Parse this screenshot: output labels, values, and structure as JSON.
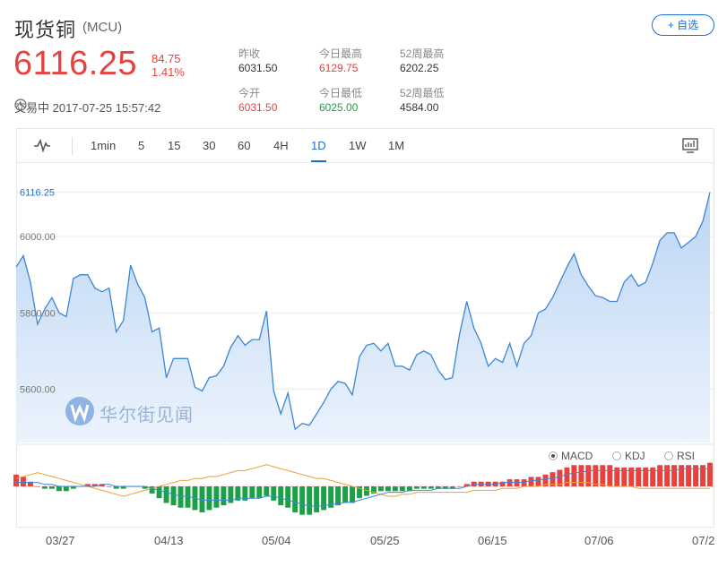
{
  "header": {
    "name": "现货铜",
    "code": "(MCU)",
    "watch_label": "+ 自选",
    "price": "6116.25",
    "change": "84.75",
    "change_pct": "1.41%",
    "status": "交易中 2017-07-25 15:57:42"
  },
  "stats": [
    {
      "label": "昨收",
      "value": "6031.50",
      "tone": "dark"
    },
    {
      "label": "今日最高",
      "value": "6129.75",
      "tone": "red"
    },
    {
      "label": "52周最高",
      "value": "6202.25",
      "tone": "dark"
    },
    {
      "label": "今开",
      "value": "6031.50",
      "tone": "red"
    },
    {
      "label": "今日最低",
      "value": "6025.00",
      "tone": "green"
    },
    {
      "label": "52周最低",
      "value": "4584.00",
      "tone": "dark"
    }
  ],
  "toolbar": {
    "periods": [
      "1min",
      "5",
      "15",
      "30",
      "60",
      "4H",
      "1D",
      "1W",
      "1M"
    ],
    "active": "1D"
  },
  "indicators": [
    {
      "label": "MACD",
      "selected": true
    },
    {
      "label": "KDJ",
      "selected": false
    },
    {
      "label": "RSI",
      "selected": false
    }
  ],
  "watermark": "华尔街见闻",
  "colors": {
    "accent": "#1a6fd1",
    "up": "#e8413e",
    "down": "#1aa145",
    "line": "#3b86d8",
    "fill": "#cfe1f7"
  },
  "chart_data": {
    "type": "area",
    "y_labels": [
      "6116.25",
      "6000.00",
      "5800.00",
      "5600.00"
    ],
    "x_labels": [
      "03/27",
      "04/13",
      "05/04",
      "05/25",
      "06/15",
      "07/06",
      "07/2"
    ],
    "ylim": [
      5460,
      6160
    ],
    "x": [
      "03/20",
      "03/21",
      "03/22",
      "03/23",
      "03/24",
      "03/27",
      "03/28",
      "03/29",
      "03/30",
      "03/31",
      "04/03",
      "04/04",
      "04/05",
      "04/06",
      "04/07",
      "04/10",
      "04/11",
      "04/12",
      "04/13",
      "04/14",
      "04/17",
      "04/18",
      "04/19",
      "04/20",
      "04/21",
      "04/24",
      "04/25",
      "04/26",
      "04/27",
      "04/28",
      "05/01",
      "05/02",
      "05/03",
      "05/04",
      "05/05",
      "05/08",
      "05/09",
      "05/10",
      "05/11",
      "05/12",
      "05/15",
      "05/16",
      "05/17",
      "05/18",
      "05/19",
      "05/22",
      "05/23",
      "05/24",
      "05/25",
      "05/26",
      "05/29",
      "05/30",
      "05/31",
      "06/01",
      "06/02",
      "06/05",
      "06/06",
      "06/07",
      "06/08",
      "06/09",
      "06/12",
      "06/13",
      "06/14",
      "06/15",
      "06/16",
      "06/19",
      "06/20",
      "06/21",
      "06/22",
      "06/23",
      "06/26",
      "06/27",
      "06/28",
      "06/29",
      "06/30",
      "07/03",
      "07/04",
      "07/05",
      "07/06",
      "07/07",
      "07/10",
      "07/11",
      "07/12",
      "07/13",
      "07/14",
      "07/17",
      "07/18",
      "07/19",
      "07/20",
      "07/21",
      "07/24",
      "07/25"
    ],
    "values": [
      5920,
      5950,
      5880,
      5770,
      5810,
      5840,
      5800,
      5790,
      5890,
      5900,
      5900,
      5865,
      5855,
      5865,
      5750,
      5780,
      5925,
      5875,
      5840,
      5750,
      5760,
      5630,
      5680,
      5680,
      5680,
      5605,
      5595,
      5630,
      5635,
      5660,
      5710,
      5740,
      5715,
      5730,
      5730,
      5805,
      5595,
      5535,
      5590,
      5495,
      5510,
      5505,
      5535,
      5565,
      5600,
      5620,
      5615,
      5585,
      5685,
      5715,
      5720,
      5700,
      5720,
      5660,
      5660,
      5650,
      5690,
      5700,
      5690,
      5650,
      5625,
      5630,
      5745,
      5830,
      5760,
      5720,
      5660,
      5680,
      5670,
      5720,
      5660,
      5720,
      5740,
      5800,
      5810,
      5840,
      5880,
      5920,
      5955,
      5900,
      5870,
      5845,
      5840,
      5830,
      5830,
      5880,
      5900,
      5870,
      5880,
      5930,
      5990,
      6010,
      6010,
      5970,
      5985,
      6000,
      6040,
      6116.25
    ],
    "macd_dif": [
      5,
      4,
      2,
      0,
      -1,
      -1,
      -2,
      -2,
      -1,
      0,
      1,
      1,
      1,
      0,
      -1,
      -1,
      0,
      0,
      -1,
      -3,
      -5,
      -7,
      -8,
      -9,
      -9,
      -10,
      -11,
      -10,
      -9,
      -8,
      -7,
      -6,
      -6,
      -5,
      -5,
      -4,
      -6,
      -8,
      -9,
      -11,
      -12,
      -12,
      -11,
      -10,
      -9,
      -8,
      -7,
      -7,
      -5,
      -4,
      -3,
      -2,
      -2,
      -2,
      -2,
      -2,
      -1,
      -1,
      -1,
      -1,
      -1,
      -1,
      0,
      1,
      2,
      2,
      2,
      2,
      2,
      3,
      3,
      3,
      4,
      4,
      5,
      6,
      7,
      8,
      9,
      9,
      9,
      9,
      9,
      9,
      8,
      8,
      8,
      8,
      8,
      8,
      9,
      9,
      9,
      9,
      9,
      9,
      9,
      10
    ],
    "macd_dea": [
      2,
      2,
      2,
      2,
      1,
      1,
      0,
      0,
      0,
      0,
      0,
      0,
      1,
      1,
      0,
      0,
      0,
      0,
      0,
      -1,
      -2,
      -3,
      -4,
      -5,
      -5,
      -6,
      -7,
      -7,
      -7,
      -7,
      -7,
      -6,
      -6,
      -6,
      -6,
      -5,
      -5,
      -6,
      -7,
      -8,
      -9,
      -10,
      -10,
      -10,
      -9,
      -9,
      -8,
      -8,
      -7,
      -6,
      -5,
      -4,
      -3,
      -3,
      -3,
      -2,
      -2,
      -2,
      -2,
      -1,
      -1,
      -1,
      -1,
      0,
      1,
      1,
      1,
      1,
      2,
      2,
      2,
      2,
      3,
      3,
      4,
      4,
      5,
      6,
      7,
      7,
      8,
      8,
      8,
      8,
      8,
      8,
      8,
      8,
      8,
      8,
      8,
      8,
      8,
      9,
      9,
      9,
      9,
      9
    ],
    "macd_k": [
      8,
      9,
      10,
      11,
      10,
      9,
      8,
      7,
      6,
      5,
      4,
      3,
      2,
      1,
      0,
      -1,
      0,
      1,
      2,
      3,
      4,
      5,
      6,
      7,
      7,
      8,
      8,
      9,
      9,
      10,
      11,
      12,
      12,
      13,
      14,
      15,
      14,
      13,
      12,
      11,
      10,
      9,
      8,
      8,
      7,
      6,
      5,
      4,
      3,
      2,
      1,
      0,
      -1,
      -1,
      0,
      0,
      1,
      1,
      1,
      1,
      1,
      1,
      1,
      1,
      2,
      2,
      2,
      2,
      3,
      3,
      3,
      4,
      4,
      4,
      5,
      5,
      5,
      6,
      6,
      6,
      6,
      5,
      5,
      4,
      4,
      4,
      4,
      3,
      3,
      3,
      3,
      3,
      3,
      3,
      3,
      3,
      3,
      3
    ]
  }
}
